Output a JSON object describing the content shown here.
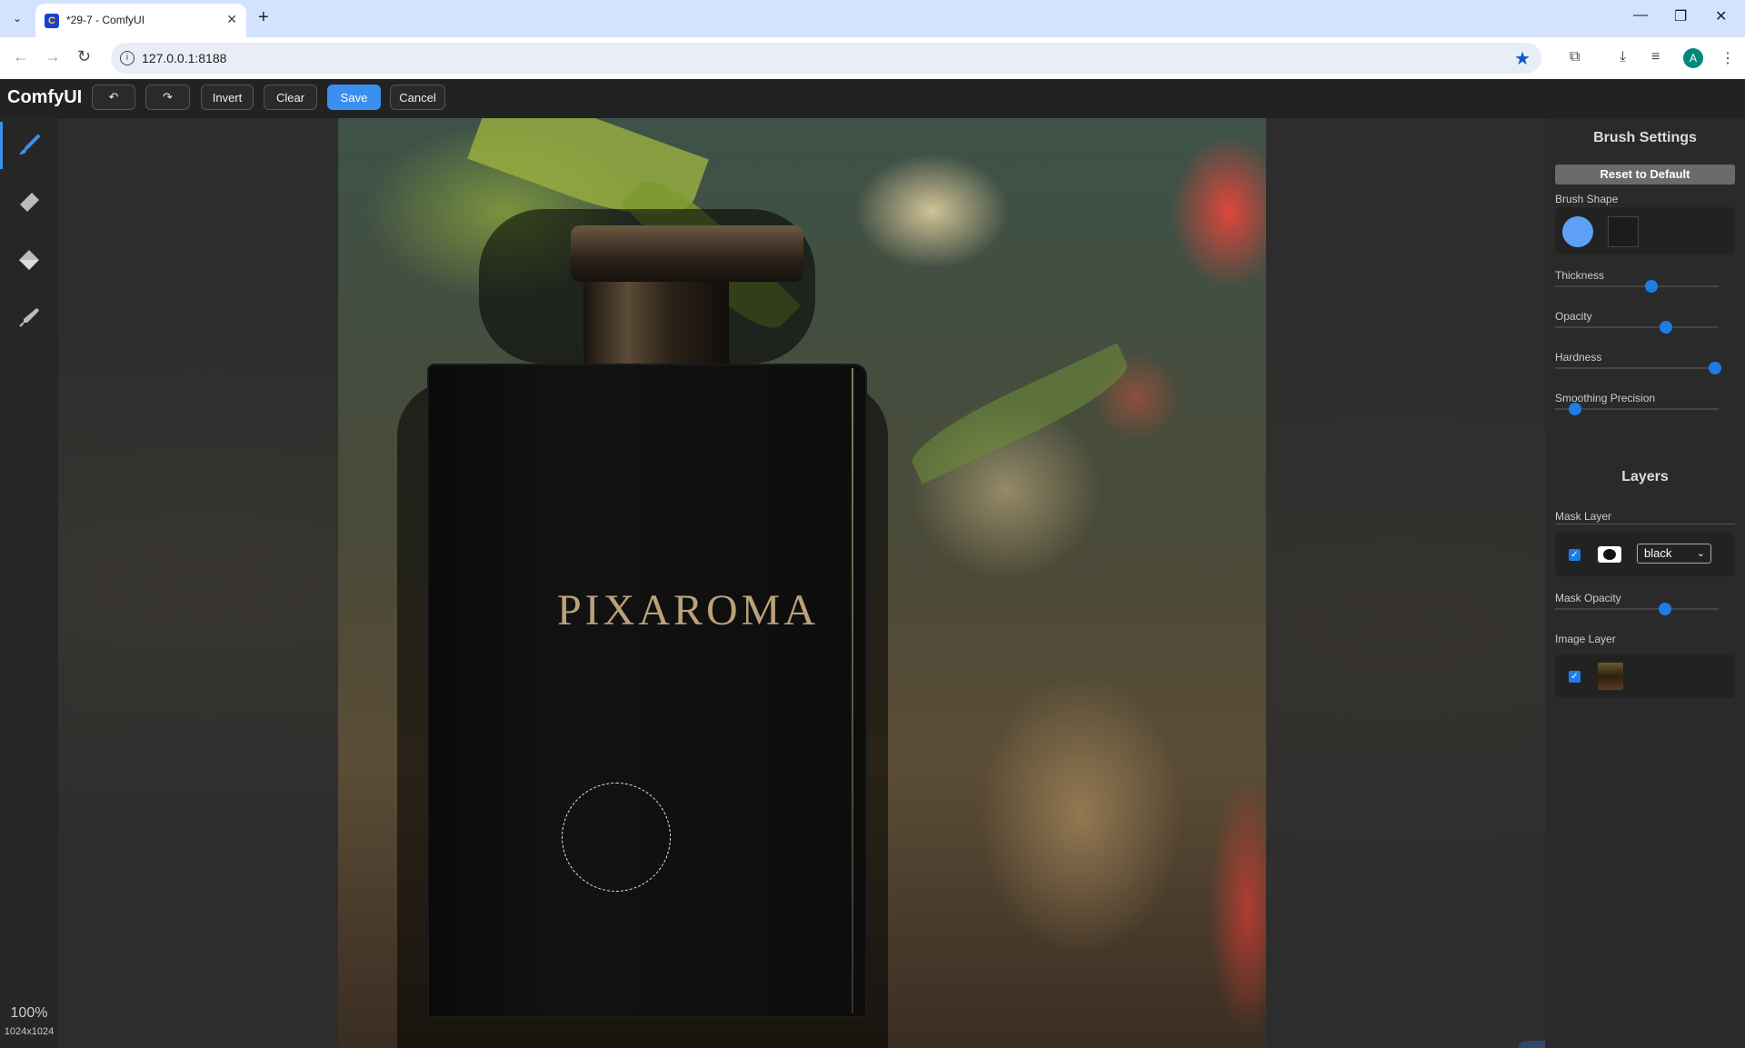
{
  "browser": {
    "tab_title": "*29-7 - ComfyUI",
    "url": "127.0.0.1:8188",
    "avatar_letter": "A"
  },
  "toolbar": {
    "brand": "ComfyUI",
    "invert_label": "Invert",
    "clear_label": "Clear",
    "save_label": "Save",
    "cancel_label": "Cancel"
  },
  "canvas": {
    "zoom": "100%",
    "dimensions": "1024x1024",
    "image_text": "PIXAROMA"
  },
  "brush_settings": {
    "title": "Brush Settings",
    "reset_label": "Reset to Default",
    "brush_shape_label": "Brush Shape",
    "thickness_label": "Thickness",
    "opacity_label": "Opacity",
    "hardness_label": "Hardness",
    "smoothing_label": "Smoothing Precision",
    "thickness_value": 0.59,
    "opacity_value": 0.68,
    "hardness_value": 0.98,
    "smoothing_value": 0.12
  },
  "layers": {
    "title": "Layers",
    "mask_layer_label": "Mask Layer",
    "mask_color": "black",
    "mask_opacity_label": "Mask Opacity",
    "mask_opacity_value": 0.67,
    "image_layer_label": "Image Layer"
  },
  "colors": {
    "accent": "#3b8ff0",
    "slider": "#1e7ce6"
  }
}
